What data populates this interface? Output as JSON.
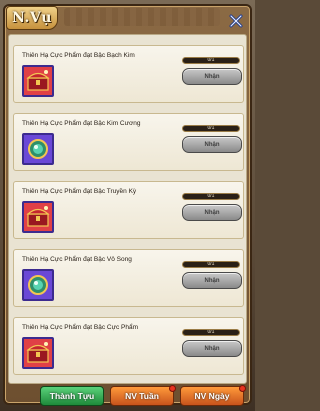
{
  "title": "N.Vụ",
  "quests": [
    {
      "name": "Thiên Hạ Cực Phẩm đạt Bậc Bạch Kim",
      "progress": "0/1",
      "progress_value": 0.0,
      "claim_label": "Nhận",
      "icon": "red-treasure-chest-icon"
    },
    {
      "name": "Thiên Hạ Cực Phẩm đạt Bậc Kim Cương",
      "progress": "0/1",
      "progress_value": 0.0,
      "claim_label": "Nhận",
      "icon": "purple-orb-icon"
    },
    {
      "name": "Thiên Hạ Cực Phẩm đạt Bậc Truyền Kỳ",
      "progress": "0/1",
      "progress_value": 0.0,
      "claim_label": "Nhận",
      "icon": "red-treasure-chest-icon"
    },
    {
      "name": "Thiên Hạ Cực Phẩm đạt Bậc Vô Song",
      "progress": "0/1",
      "progress_value": 0.0,
      "claim_label": "Nhận",
      "icon": "purple-orb-icon"
    },
    {
      "name": "Thiên Hạ Cực Phẩm đạt Bậc Cực Phẩm",
      "progress": "0/1",
      "progress_value": 0.0,
      "claim_label": "Nhận",
      "icon": "red-treasure-chest-icon"
    }
  ],
  "tabs": [
    {
      "label": "Thành Tựu",
      "active": true
    },
    {
      "label": "NV Tuần",
      "active": false
    },
    {
      "label": "NV Ngày",
      "active": false
    }
  ],
  "colors": {
    "active_tab": "#2fa84f",
    "inactive_tab": "#e06a24",
    "badge": "#e8331f",
    "panel": "#e9e3d2"
  }
}
